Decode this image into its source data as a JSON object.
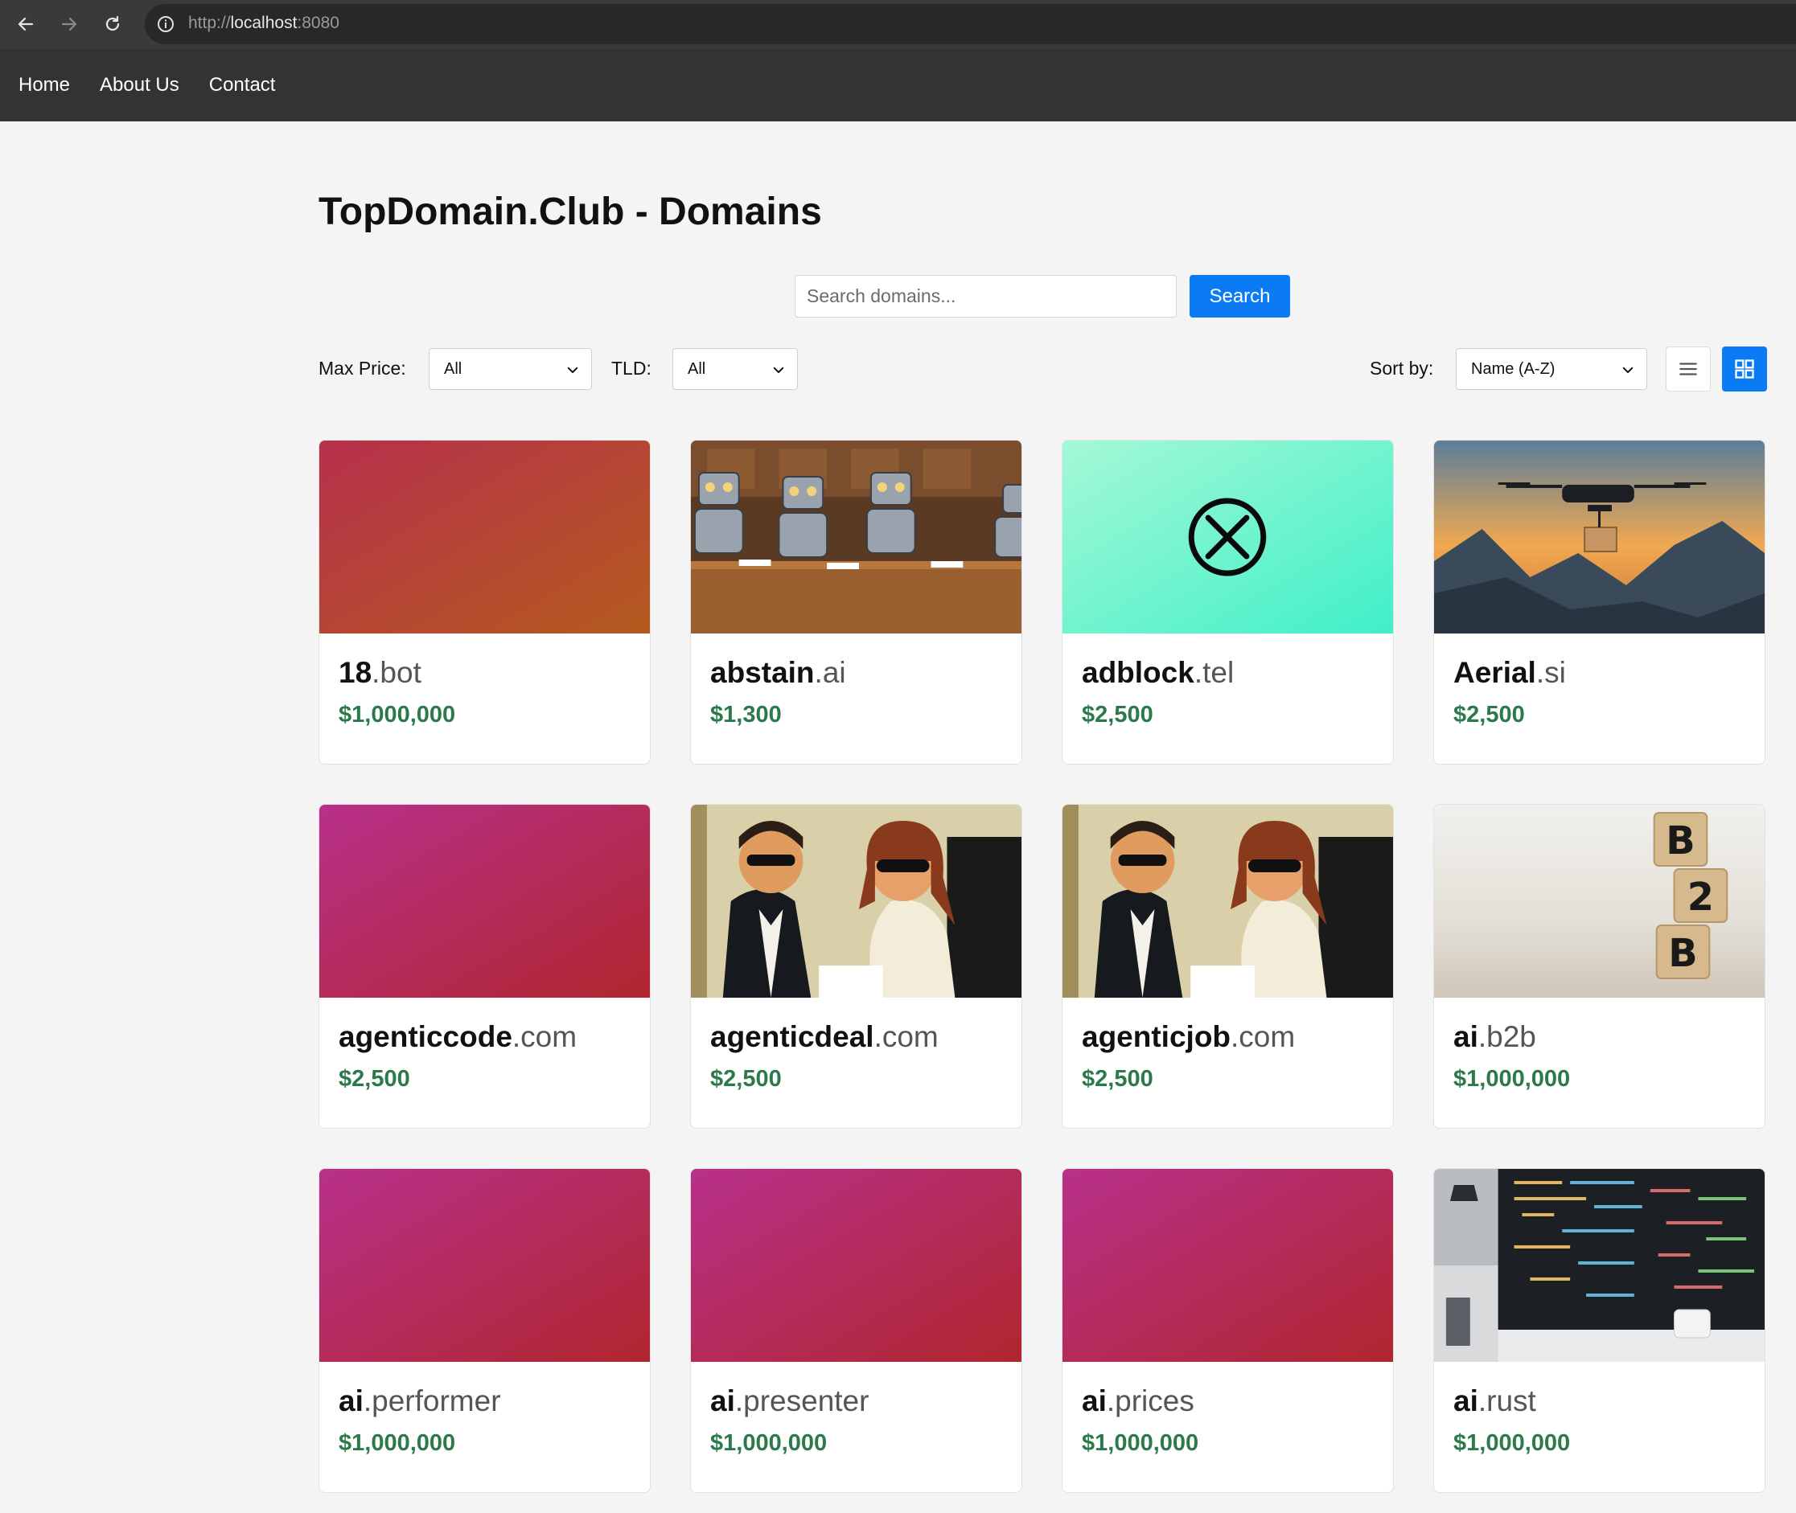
{
  "browser": {
    "url_scheme": "http://",
    "url_host": "localhost",
    "url_port": ":8080"
  },
  "nav": {
    "links": [
      "Home",
      "About Us",
      "Contact"
    ]
  },
  "page": {
    "title": "TopDomain.Club - Domains"
  },
  "search": {
    "placeholder": "Search domains...",
    "button_label": "Search"
  },
  "filters": {
    "max_price_label": "Max Price:",
    "max_price_value": "All",
    "tld_label": "TLD:",
    "tld_value": "All",
    "sort_label": "Sort by:",
    "sort_value": "Name (A-Z)"
  },
  "view_toggle": {
    "active": "grid"
  },
  "colors": {
    "accent": "#0a7bf5",
    "price": "#2c7a4b",
    "nav_bg": "#333333"
  },
  "cards": [
    {
      "sld": "18",
      "tld": ".bot",
      "price": "$1,000,000",
      "media": "gradient-red-orange"
    },
    {
      "sld": "abstain",
      "tld": ".ai",
      "price": "$1,300",
      "media": "robots-at-desk-image"
    },
    {
      "sld": "adblock",
      "tld": ".tel",
      "price": "$2,500",
      "media": "x-circle-icon"
    },
    {
      "sld": "Aerial",
      "tld": ".si",
      "price": "$2,500",
      "media": "drone-over-mountains-image"
    },
    {
      "sld": "agenticcode",
      "tld": ".com",
      "price": "$2,500",
      "media": "gradient-magenta-red"
    },
    {
      "sld": "agenticdeal",
      "tld": ".com",
      "price": "$2,500",
      "media": "retro-spy-couple-image"
    },
    {
      "sld": "agenticjob",
      "tld": ".com",
      "price": "$2,500",
      "media": "retro-spy-couple-image"
    },
    {
      "sld": "ai",
      "tld": ".b2b",
      "price": "$1,000,000",
      "media": "b2b-wooden-blocks-image"
    },
    {
      "sld": "ai",
      "tld": ".performer",
      "price": "$1,000,000",
      "media": "gradient-magenta-red"
    },
    {
      "sld": "ai",
      "tld": ".presenter",
      "price": "$1,000,000",
      "media": "gradient-magenta-red"
    },
    {
      "sld": "ai",
      "tld": ".prices",
      "price": "$1,000,000",
      "media": "gradient-magenta-red"
    },
    {
      "sld": "ai",
      "tld": ".rust",
      "price": "$1,000,000",
      "media": "code-monitor-image"
    }
  ],
  "b2b_block_letters": [
    "B",
    "2",
    "B"
  ]
}
